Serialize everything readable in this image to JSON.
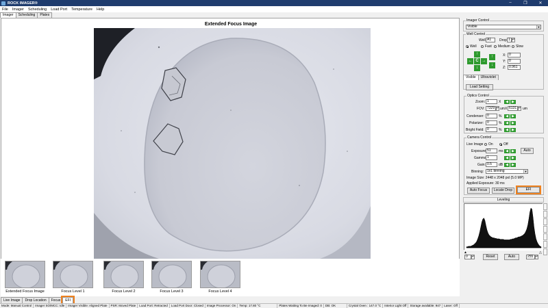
{
  "window": {
    "title": "ROCK IMAGER®",
    "controls": [
      "–",
      "❐",
      "✕"
    ]
  },
  "menu": [
    "File",
    "Imager",
    "Scheduling",
    "Load Port",
    "Temperature",
    "Help"
  ],
  "top_tabs": [
    "Imager",
    "Scheduling",
    "Plates"
  ],
  "image_view": {
    "title": "Extended Focus Image"
  },
  "thumbnails": [
    "Extended Focus Image",
    "Focus Level 1",
    "Focus Level 2",
    "Focus Level 3",
    "Focus Level 4"
  ],
  "bottom_tabs": [
    "Live Image",
    "Drop Location",
    "Focus",
    "EFI"
  ],
  "status": [
    "Mode: Manual Control",
    "Imager SO/MCC: Idle",
    "Imager Visible: Aligned Plate",
    "PSR: Moved Plate",
    "Load Port: Retracted",
    "Load Port Door: Closed",
    "Image Processor: On",
    "Temp: 17.80 °C",
    "Plates Waiting To Be Imaged: 0",
    "DB: OK",
    "Crystal Oven : 147.0 °C",
    "Interior Light Off",
    "Storage available: 947",
    "Laser: Off"
  ],
  "imager_control": {
    "title": "Imager Control",
    "mode": "Visible"
  },
  "well_control": {
    "title": "Well Control",
    "well_label": "Well",
    "well_value": "A1",
    "drop_label": "Drop",
    "drop_value": "1",
    "speeds": [
      "Well",
      "Fast",
      "Medium",
      "Slow"
    ],
    "center_label": "C",
    "x_label": "X:",
    "x_value": "0",
    "y_label": "Y:",
    "y_value": "0",
    "z_label": "Z:",
    "z_value": "0.961"
  },
  "light_tabs": [
    "Visible",
    "Ultraviolet"
  ],
  "load_setting": "Load Setting",
  "optics": {
    "title": "Optics Control",
    "zoom_label": "Zoom:",
    "zoom_value": "1",
    "zoom_unit": "X",
    "fov_label": "FOV:",
    "fov_w": "7329",
    "fov_unit1": "um",
    "fov_x": "X",
    "fov_h": "6131",
    "fov_unit2": "um",
    "condenser_label": "Condenser:",
    "condenser_value": "0",
    "pct": "%",
    "polarizer_label": "Polarizer:",
    "polarizer_value": "0",
    "bright_label": "Bright Field:",
    "bright_value": "0"
  },
  "camera": {
    "title": "Camera Control",
    "live_label": "Live Image",
    "on_label": "On",
    "off_label": "Off",
    "exposure_label": "Exposure:",
    "exposure_value": "51",
    "exposure_unit": "ms",
    "auto_label": "Auto",
    "gamma_label": "Gamma:",
    "gamma_value": "1",
    "gain_label": "Gain:",
    "gain_value": "0.5",
    "gain_unit": "dB",
    "binning_label": "Binning:",
    "binning_value": "1x1 binning",
    "image_size": "Image Size: 2448 x 2048 pxl (5.0 MP)",
    "applied_exposure": "Applied Exposure: 30 ms",
    "auto_focus": "Auto Focus",
    "locate_drop": "Locate Drop",
    "efi": "EFI"
  },
  "leveling": {
    "title": "Leveling",
    "min_value": "0",
    "reset": "Reset",
    "auto": "Auto",
    "max_value": "255",
    "histogram": [
      2,
      2,
      3,
      3,
      3,
      4,
      5,
      6,
      8,
      10,
      13,
      18,
      24,
      32,
      42,
      52,
      58,
      60,
      55,
      45,
      36,
      30,
      26,
      24,
      22,
      21,
      20,
      20,
      19,
      19,
      18,
      18,
      18,
      17,
      17,
      17,
      17,
      16,
      16,
      16,
      16,
      16,
      16,
      17,
      17,
      18,
      18,
      19,
      20,
      20,
      21,
      22,
      22,
      23,
      24,
      25,
      27,
      29,
      33,
      38,
      46,
      58,
      72,
      80,
      78,
      62,
      42,
      28,
      18,
      12,
      8,
      5,
      3,
      2
    ]
  },
  "colors": {
    "accent_highlight": "#f0821e",
    "nav_green": "#2e9a2e",
    "titlebar": "#1f3c6e"
  }
}
